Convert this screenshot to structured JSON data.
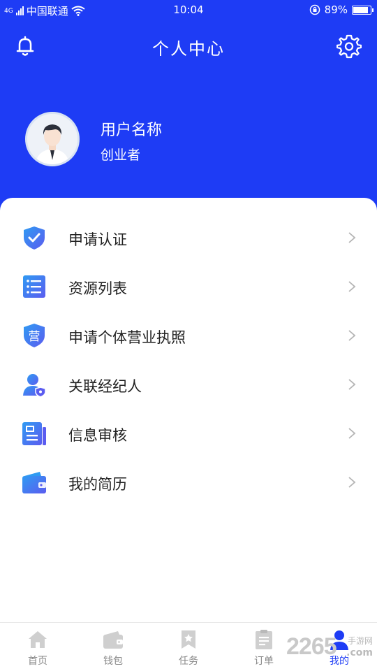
{
  "status_bar": {
    "network": "4G",
    "carrier": "中国联通",
    "time": "10:04",
    "battery": "89%",
    "battery_level": 0.89
  },
  "header": {
    "title": "个人中心",
    "notification_icon": "bell-icon",
    "settings_icon": "gear-icon"
  },
  "profile": {
    "name": "用户名称",
    "role": "创业者"
  },
  "menu": [
    {
      "label": "申请认证",
      "icon": "shield-check-icon"
    },
    {
      "label": "资源列表",
      "icon": "list-icon"
    },
    {
      "label": "申请个体营业执照",
      "icon": "license-badge-icon",
      "icon_text": "营"
    },
    {
      "label": "关联经纪人",
      "icon": "agent-user-icon"
    },
    {
      "label": "信息审核",
      "icon": "document-review-icon"
    },
    {
      "label": "我的简历",
      "icon": "wallet-icon"
    }
  ],
  "tabbar": [
    {
      "label": "首页",
      "icon": "home-icon"
    },
    {
      "label": "钱包",
      "icon": "wallet-icon"
    },
    {
      "label": "任务",
      "icon": "bookmark-icon"
    },
    {
      "label": "订单",
      "icon": "clipboard-icon"
    },
    {
      "label": "我的",
      "icon": "user-icon",
      "active": true
    }
  ],
  "watermark": {
    "number": "2265",
    "subtitle": "手游网",
    "domain": ".com"
  },
  "colors": {
    "primary": "#1e3cf5",
    "icon_gradient_start": "#2f9bf2",
    "icon_gradient_end": "#5b5cf0",
    "tab_inactive": "#cfcfcf"
  }
}
